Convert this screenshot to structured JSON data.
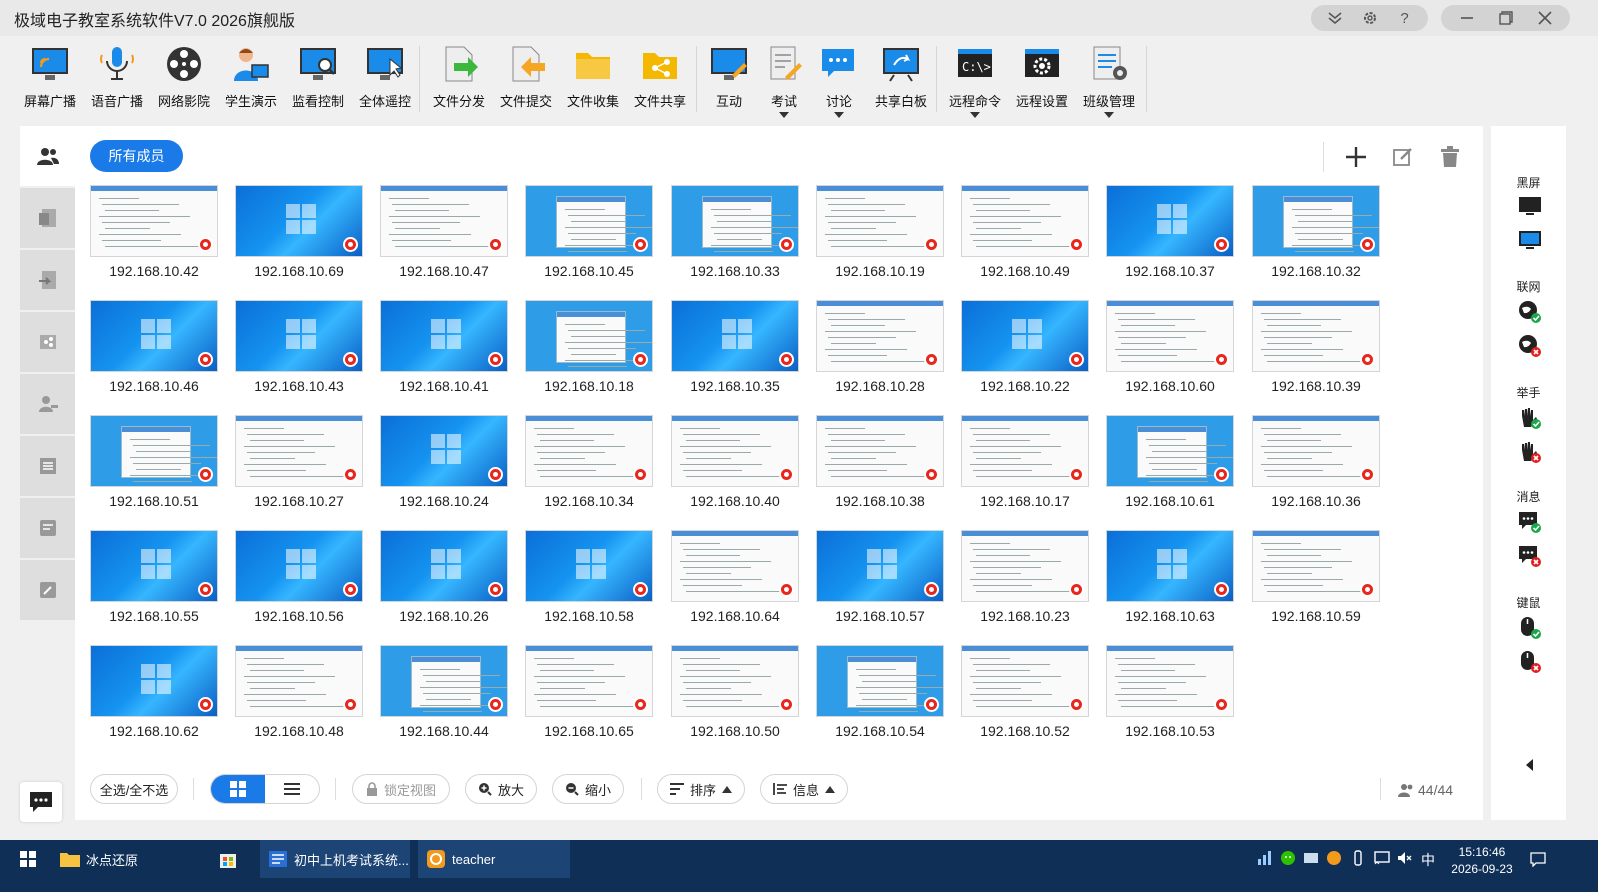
{
  "app": {
    "title": "极域电子教室系统软件V7.0 2026旗舰版"
  },
  "window_controls": [
    "menu-icon",
    "settings-icon",
    "help-icon",
    "minimize-icon",
    "restore-icon",
    "close-icon"
  ],
  "toolbar": {
    "items": [
      {
        "label": "屏幕广播",
        "icon": "screen-broadcast-icon"
      },
      {
        "label": "语音广播",
        "icon": "microphone-icon"
      },
      {
        "label": "网络影院",
        "icon": "film-reel-icon"
      },
      {
        "label": "学生演示",
        "icon": "student-demo-icon"
      },
      {
        "label": "监看控制",
        "icon": "monitor-control-icon"
      },
      {
        "label": "全体遥控",
        "icon": "remote-control-all-icon"
      },
      {
        "label": "文件分发",
        "icon": "file-distribute-icon"
      },
      {
        "label": "文件提交",
        "icon": "file-submit-icon"
      },
      {
        "label": "文件收集",
        "icon": "file-collect-icon"
      },
      {
        "label": "文件共享",
        "icon": "file-share-icon"
      },
      {
        "label": "互动",
        "icon": "interact-icon"
      },
      {
        "label": "考试",
        "icon": "exam-icon"
      },
      {
        "label": "讨论",
        "icon": "discussion-icon"
      },
      {
        "label": "共享白板",
        "icon": "whiteboard-icon"
      },
      {
        "label": "远程命令",
        "icon": "command-prompt-icon"
      },
      {
        "label": "远程设置",
        "icon": "remote-settings-icon"
      },
      {
        "label": "班级管理",
        "icon": "class-management-icon"
      }
    ]
  },
  "main": {
    "group_button": "所有成员",
    "students": [
      {
        "ip": "192.168.10.42",
        "screen": "doc"
      },
      {
        "ip": "192.168.10.69",
        "screen": "desk"
      },
      {
        "ip": "192.168.10.47",
        "screen": "doc"
      },
      {
        "ip": "192.168.10.45",
        "screen": "dlg"
      },
      {
        "ip": "192.168.10.33",
        "screen": "dlg"
      },
      {
        "ip": "192.168.10.19",
        "screen": "doc"
      },
      {
        "ip": "192.168.10.49",
        "screen": "doc"
      },
      {
        "ip": "192.168.10.37",
        "screen": "desk"
      },
      {
        "ip": "192.168.10.32",
        "screen": "dlg"
      },
      {
        "ip": "192.168.10.46",
        "screen": "desk"
      },
      {
        "ip": "192.168.10.43",
        "screen": "desk"
      },
      {
        "ip": "192.168.10.41",
        "screen": "desk"
      },
      {
        "ip": "192.168.10.18",
        "screen": "dlg"
      },
      {
        "ip": "192.168.10.35",
        "screen": "desk"
      },
      {
        "ip": "192.168.10.28",
        "screen": "doc"
      },
      {
        "ip": "192.168.10.22",
        "screen": "desk"
      },
      {
        "ip": "192.168.10.60",
        "screen": "doc"
      },
      {
        "ip": "192.168.10.39",
        "screen": "doc"
      },
      {
        "ip": "192.168.10.51",
        "screen": "dlg"
      },
      {
        "ip": "192.168.10.27",
        "screen": "doc"
      },
      {
        "ip": "192.168.10.24",
        "screen": "desk"
      },
      {
        "ip": "192.168.10.34",
        "screen": "doc"
      },
      {
        "ip": "192.168.10.40",
        "screen": "doc"
      },
      {
        "ip": "192.168.10.38",
        "screen": "doc"
      },
      {
        "ip": "192.168.10.17",
        "screen": "doc"
      },
      {
        "ip": "192.168.10.61",
        "screen": "dlg"
      },
      {
        "ip": "192.168.10.36",
        "screen": "doc"
      },
      {
        "ip": "192.168.10.55",
        "screen": "desk"
      },
      {
        "ip": "192.168.10.56",
        "screen": "desk"
      },
      {
        "ip": "192.168.10.26",
        "screen": "desk"
      },
      {
        "ip": "192.168.10.58",
        "screen": "desk"
      },
      {
        "ip": "192.168.10.64",
        "screen": "doc"
      },
      {
        "ip": "192.168.10.57",
        "screen": "desk"
      },
      {
        "ip": "192.168.10.23",
        "screen": "doc"
      },
      {
        "ip": "192.168.10.63",
        "screen": "desk"
      },
      {
        "ip": "192.168.10.59",
        "screen": "doc"
      },
      {
        "ip": "192.168.10.62",
        "screen": "desk"
      },
      {
        "ip": "192.168.10.48",
        "screen": "doc"
      },
      {
        "ip": "192.168.10.44",
        "screen": "dlg"
      },
      {
        "ip": "192.168.10.65",
        "screen": "doc"
      },
      {
        "ip": "192.168.10.50",
        "screen": "doc"
      },
      {
        "ip": "192.168.10.54",
        "screen": "dlg"
      },
      {
        "ip": "192.168.10.52",
        "screen": "doc"
      },
      {
        "ip": "192.168.10.53",
        "screen": "doc"
      }
    ],
    "bottom": {
      "select_all": "全选/全不选",
      "lock_view": "锁定视图",
      "zoom_in": "放大",
      "zoom_out": "缩小",
      "sort": "排序",
      "info": "信息",
      "count": "44/44"
    }
  },
  "rightbar": {
    "sections": [
      {
        "label": "黑屏"
      },
      {
        "label": "联网"
      },
      {
        "label": "举手"
      },
      {
        "label": "消息"
      },
      {
        "label": "键鼠"
      }
    ]
  },
  "taskbar": {
    "items": [
      {
        "label": "冰点还原"
      },
      {
        "label": ""
      },
      {
        "label": "初中上机考试系统..."
      },
      {
        "label": "teacher"
      }
    ],
    "time": "15:16:46",
    "date": "2026-09-23",
    "ime": "中"
  },
  "colors": {
    "accent": "#1a7be8",
    "badge": "#e8261c",
    "taskbar": "#0f2f57"
  }
}
